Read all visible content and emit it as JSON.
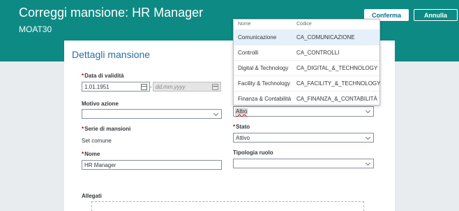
{
  "header": {
    "title": "Correggi mansione: HR Manager",
    "subtitle": "MOAT30",
    "confirm_label": "Conferma",
    "cancel_label": "Annulla"
  },
  "card": {
    "title": "Dettagli mansione"
  },
  "form": {
    "data_validita": {
      "label": "Data di validità",
      "required": "*",
      "value": "1.01.1951",
      "end_placeholder": "dd.mm.yyyy",
      "separator": "-"
    },
    "motivo_azione": {
      "label": "Motivo azione",
      "value": ""
    },
    "serie_mansioni": {
      "label": "Serie di mansioni",
      "required": "*",
      "value": "Set comune"
    },
    "nome": {
      "label": "Nome",
      "required": "*",
      "value": "HR Manager"
    },
    "allegati": {
      "label": "Allegati"
    },
    "categoria": {
      "value": "Altro"
    },
    "stato": {
      "label": "Stato",
      "required": "*",
      "value": "Attivo"
    },
    "tipologia_ruolo": {
      "label": "Tipologia ruolo",
      "value": ""
    }
  },
  "popup": {
    "headers": {
      "name": "Nome",
      "code": "Codice"
    },
    "rows": [
      {
        "name": "Comunicazione",
        "code": "CA_COMUNICAZIONE"
      },
      {
        "name": "Controlli",
        "code": "CA_CONTROLLI"
      },
      {
        "name": "Digital & Technology",
        "code": "CA_DIGITAL_&_TECHNOLOGY"
      },
      {
        "name": "Facility & Technology",
        "code": "CA_FACILITY_&_TECHNOLOGY"
      },
      {
        "name": "Finanza & Contabilità",
        "code": "CA_FINANZA_&_CONTABILITÀ"
      }
    ]
  },
  "colors": {
    "header_bg": "#0e8a84",
    "accent": "#2a6fa5",
    "required": "#bb0000"
  },
  "icons": [
    "calendar-icon",
    "chevron-down-icon"
  ]
}
